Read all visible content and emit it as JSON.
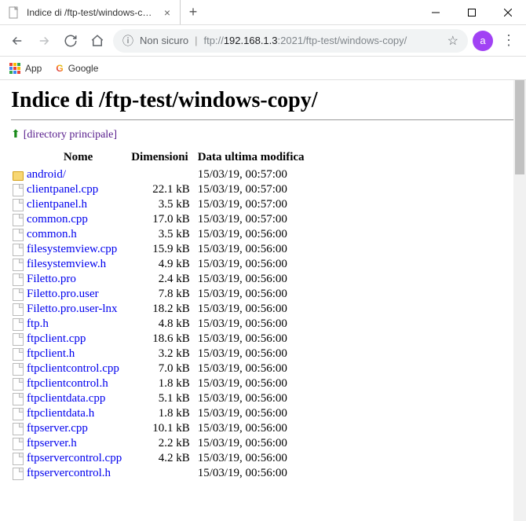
{
  "tab": {
    "title": "Indice di /ftp-test/windows-copy"
  },
  "addr": {
    "insecure": "Non sicuro",
    "proto": "ftp://",
    "host": "192.168.1.3",
    "port": ":2021",
    "path": "/ftp-test/windows-copy/"
  },
  "avatar": "a",
  "bookmarks": {
    "apps": "App",
    "google": "Google"
  },
  "page": {
    "heading": "Indice di /ftp-test/windows-copy/",
    "parent": "[directory principale]",
    "cols": {
      "name": "Nome",
      "size": "Dimensioni",
      "date": "Data ultima modifica"
    },
    "rows": [
      {
        "icon": "folder",
        "name": "android/",
        "size": "",
        "date": "15/03/19, 00:57:00"
      },
      {
        "icon": "file",
        "name": "clientpanel.cpp",
        "size": "22.1 kB",
        "date": "15/03/19, 00:57:00"
      },
      {
        "icon": "file",
        "name": "clientpanel.h",
        "size": "3.5 kB",
        "date": "15/03/19, 00:57:00"
      },
      {
        "icon": "file",
        "name": "common.cpp",
        "size": "17.0 kB",
        "date": "15/03/19, 00:57:00"
      },
      {
        "icon": "file",
        "name": "common.h",
        "size": "3.5 kB",
        "date": "15/03/19, 00:56:00"
      },
      {
        "icon": "file",
        "name": "filesystemview.cpp",
        "size": "15.9 kB",
        "date": "15/03/19, 00:56:00"
      },
      {
        "icon": "file",
        "name": "filesystemview.h",
        "size": "4.9 kB",
        "date": "15/03/19, 00:56:00"
      },
      {
        "icon": "file",
        "name": "Filetto.pro",
        "size": "2.4 kB",
        "date": "15/03/19, 00:56:00"
      },
      {
        "icon": "file",
        "name": "Filetto.pro.user",
        "size": "7.8 kB",
        "date": "15/03/19, 00:56:00"
      },
      {
        "icon": "file",
        "name": "Filetto.pro.user-lnx",
        "size": "18.2 kB",
        "date": "15/03/19, 00:56:00"
      },
      {
        "icon": "file",
        "name": "ftp.h",
        "size": "4.8 kB",
        "date": "15/03/19, 00:56:00"
      },
      {
        "icon": "file",
        "name": "ftpclient.cpp",
        "size": "18.6 kB",
        "date": "15/03/19, 00:56:00"
      },
      {
        "icon": "file",
        "name": "ftpclient.h",
        "size": "3.2 kB",
        "date": "15/03/19, 00:56:00"
      },
      {
        "icon": "file",
        "name": "ftpclientcontrol.cpp",
        "size": "7.0 kB",
        "date": "15/03/19, 00:56:00"
      },
      {
        "icon": "file",
        "name": "ftpclientcontrol.h",
        "size": "1.8 kB",
        "date": "15/03/19, 00:56:00"
      },
      {
        "icon": "file",
        "name": "ftpclientdata.cpp",
        "size": "5.1 kB",
        "date": "15/03/19, 00:56:00"
      },
      {
        "icon": "file",
        "name": "ftpclientdata.h",
        "size": "1.8 kB",
        "date": "15/03/19, 00:56:00"
      },
      {
        "icon": "file",
        "name": "ftpserver.cpp",
        "size": "10.1 kB",
        "date": "15/03/19, 00:56:00"
      },
      {
        "icon": "file",
        "name": "ftpserver.h",
        "size": "2.2 kB",
        "date": "15/03/19, 00:56:00"
      },
      {
        "icon": "file",
        "name": "ftpservercontrol.cpp",
        "size": "4.2 kB",
        "date": "15/03/19, 00:56:00"
      },
      {
        "icon": "file",
        "name": "ftpservercontrol.h",
        "size": "",
        "date": "15/03/19, 00:56:00"
      }
    ]
  }
}
